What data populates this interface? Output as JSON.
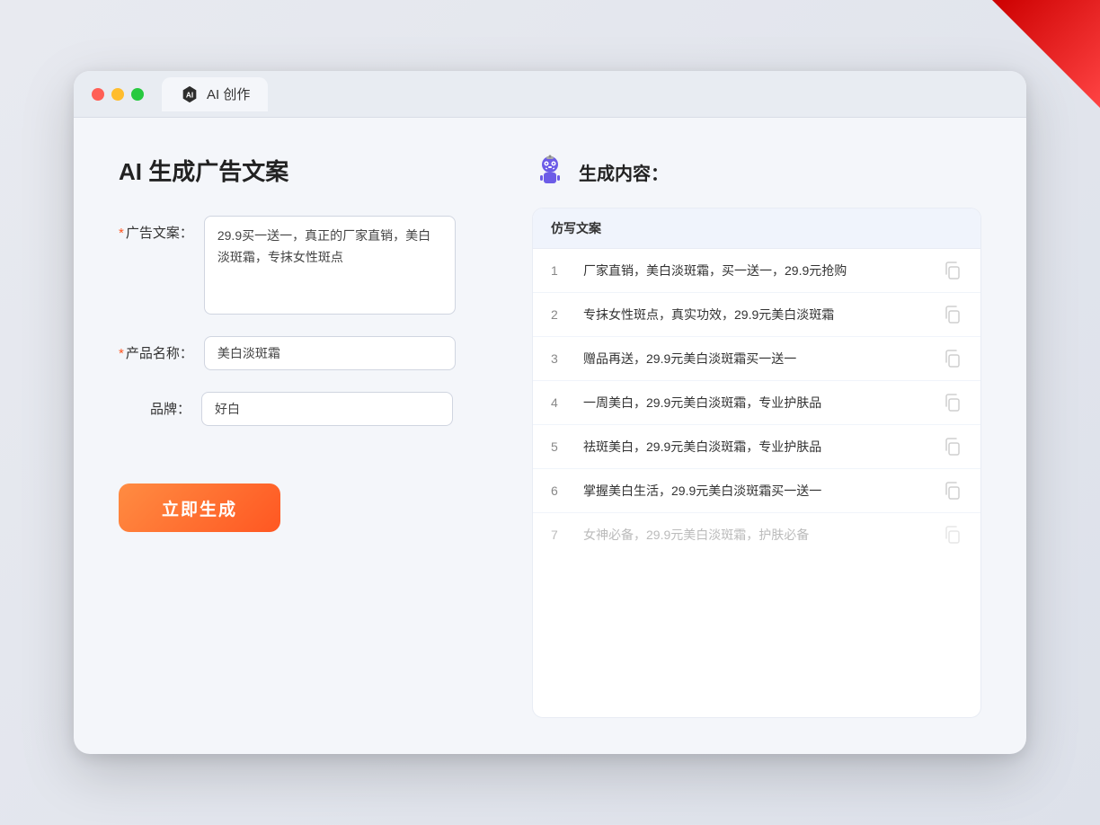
{
  "window": {
    "title": "AI 创作",
    "tab_label": "AI 创作"
  },
  "left_panel": {
    "page_title": "AI 生成广告文案",
    "fields": [
      {
        "label": "广告文案：",
        "required": true,
        "type": "textarea",
        "value": "29.9买一送一，真正的厂家直销，美白淡斑霜，专抹女性斑点",
        "placeholder": ""
      },
      {
        "label": "产品名称：",
        "required": true,
        "type": "input",
        "value": "美白淡斑霜",
        "placeholder": ""
      },
      {
        "label": "品牌：",
        "required": false,
        "type": "input",
        "value": "好白",
        "placeholder": ""
      }
    ],
    "generate_button": "立即生成"
  },
  "right_panel": {
    "title": "生成内容：",
    "table_header": "仿写文案",
    "rows": [
      {
        "num": "1",
        "text": "厂家直销，美白淡斑霜，买一送一，29.9元抢购",
        "faded": false
      },
      {
        "num": "2",
        "text": "专抹女性斑点，真实功效，29.9元美白淡斑霜",
        "faded": false
      },
      {
        "num": "3",
        "text": "赠品再送，29.9元美白淡斑霜买一送一",
        "faded": false
      },
      {
        "num": "4",
        "text": "一周美白，29.9元美白淡斑霜，专业护肤品",
        "faded": false
      },
      {
        "num": "5",
        "text": "祛斑美白，29.9元美白淡斑霜，专业护肤品",
        "faded": false
      },
      {
        "num": "6",
        "text": "掌握美白生活，29.9元美白淡斑霜买一送一",
        "faded": false
      },
      {
        "num": "7",
        "text": "女神必备，29.9元美白淡斑霜，护肤必备",
        "faded": true
      }
    ]
  },
  "colors": {
    "accent_orange": "#ff5722",
    "required_red": "#ff5722"
  }
}
